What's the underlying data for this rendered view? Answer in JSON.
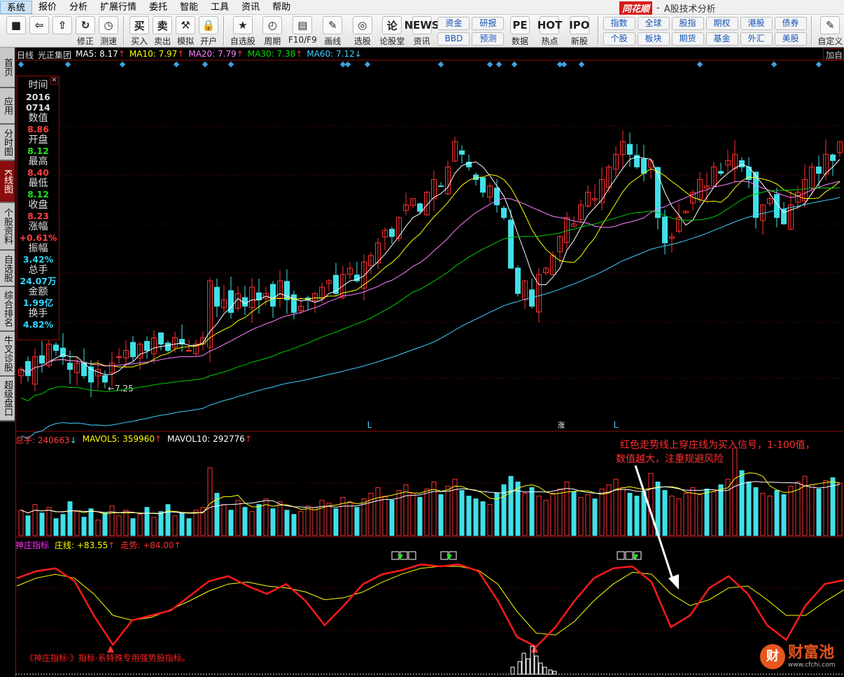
{
  "menu": [
    "系统",
    "报价",
    "分析",
    "扩展行情",
    "委托",
    "智能",
    "工具",
    "资讯",
    "帮助"
  ],
  "app_title": {
    "logo": "同花顺",
    "sep": "-",
    "subtitle": "A股技术分析"
  },
  "toolbar": {
    "left": [
      {
        "icon": "■",
        "label": ""
      },
      {
        "icon": "⇦",
        "label": ""
      },
      {
        "icon": "⇧",
        "label": ""
      },
      {
        "icon": "↻",
        "label": "修正"
      },
      {
        "icon": "◷",
        "label": "测速"
      },
      {
        "icon": "买",
        "label": "买入"
      },
      {
        "icon": "卖",
        "label": "卖出"
      },
      {
        "icon": "⚒",
        "label": "模拟"
      },
      {
        "icon": "🔒",
        "label": "开户"
      },
      {
        "icon": "★",
        "label": "自选股"
      },
      {
        "icon": "◴",
        "label": "周期"
      },
      {
        "icon": "▤",
        "label": "F10/F9"
      },
      {
        "icon": "✎",
        "label": "画线"
      },
      {
        "icon": "◎",
        "label": "选股"
      },
      {
        "icon": "论",
        "label": "论股堂"
      },
      {
        "icon": "NEWS",
        "label": "资讯"
      }
    ],
    "grid1": [
      "资金",
      "研报",
      "BBD",
      "预测"
    ],
    "mid": [
      {
        "icon": "PE",
        "label": "数据"
      },
      {
        "icon": "HOT",
        "label": "热点"
      },
      {
        "icon": "IPO",
        "label": "新股"
      }
    ],
    "grid2": [
      "指数",
      "全球",
      "股指",
      "期权",
      "港股",
      "债券",
      "个股",
      "板块",
      "期货",
      "基金",
      "外汇",
      "美股"
    ],
    "custom": {
      "icon": "✎",
      "label": "自定义"
    }
  },
  "sidebar": [
    "首页",
    "应用",
    "分时图",
    "K线图",
    "个股资料",
    "自选股",
    "综合排名",
    "牛叉诊股",
    "超级盘口"
  ],
  "header": {
    "period": "日线",
    "stock": "光正集团",
    "ma": [
      {
        "label": "MA5: 8.17",
        "arrow": "↑",
        "color": "#ffffff"
      },
      {
        "label": "MA10: 7.97",
        "arrow": "↑",
        "color": "#ffff00"
      },
      {
        "label": "MA20: 7.79",
        "arrow": "↑",
        "color": "#ff80ff"
      },
      {
        "label": "MA30: 7.38",
        "arrow": "↑",
        "color": "#00e000"
      },
      {
        "label": "MA60: 7.12",
        "arrow": "↓",
        "color": "#40d0ff"
      }
    ]
  },
  "add_self": "加自选",
  "infobox": [
    {
      "k": "时间",
      "v": "2016",
      "c": "#dddddd"
    },
    {
      "k": "",
      "v": "0714",
      "c": "#dddddd"
    },
    {
      "k": "数值",
      "v": "8.86",
      "c": "#ff4040"
    },
    {
      "k": "开盘",
      "v": "8.12",
      "c": "#20e020"
    },
    {
      "k": "最高",
      "v": "8.40",
      "c": "#ff4040"
    },
    {
      "k": "最低",
      "v": "8.12",
      "c": "#20e020"
    },
    {
      "k": "收盘",
      "v": "8.23",
      "c": "#ff4040"
    },
    {
      "k": "涨幅",
      "v": "+0.61%",
      "c": "#ff4040"
    },
    {
      "k": "振幅",
      "v": "3.42%",
      "c": "#30d8ff"
    },
    {
      "k": "总手",
      "v": "24.07万",
      "c": "#30d8ff"
    },
    {
      "k": "金额",
      "v": "1.99亿",
      "c": "#30d8ff"
    },
    {
      "k": "换手",
      "v": "4.82%",
      "c": "#30d8ff"
    }
  ],
  "price_panel": {
    "low_label": "7.25",
    "marks": [
      "L",
      "涨",
      "L"
    ]
  },
  "volume_panel": {
    "items": [
      {
        "label": "总手: 240663",
        "arrow": "↓",
        "color": "#ff4040",
        "acolor": "#40d0ff"
      },
      {
        "label": "MAVOL5: 359960",
        "arrow": "↑",
        "color": "#ffff00",
        "acolor": "#ff3030"
      },
      {
        "label": "MAVOL10: 292776",
        "arrow": "↑",
        "color": "#ffffff",
        "acolor": "#ff3030"
      }
    ]
  },
  "indicator_panel": {
    "name": "神庄指标",
    "items": [
      {
        "label": "庄线: +83.55",
        "arrow": "↑",
        "color": "#ffff00"
      },
      {
        "label": "走势: +84.00",
        "arrow": "↑",
        "color": "#ff3030"
      }
    ]
  },
  "annotation": {
    "line1": "红色走势线上穿庄线为买入信号，1-100值，",
    "line2": "数值越大，注重规避风险"
  },
  "footnote": "《神庄指标·》指标·系特殊专用强势股指标。",
  "watermark": {
    "logo": "财",
    "text": "财富池",
    "url": "www.cfchi.com"
  },
  "chart_data": {
    "type": "candlestick",
    "closes": [
      7.4,
      7.35,
      7.5,
      7.45,
      7.6,
      7.55,
      7.5,
      7.4,
      7.45,
      7.35,
      7.3,
      7.4,
      7.3,
      7.45,
      7.5,
      7.55,
      7.5,
      7.6,
      7.55,
      7.65,
      7.6,
      7.55,
      7.65,
      7.6,
      7.55,
      7.6,
      7.65,
      8.1,
      7.9,
      7.95,
      7.85,
      8.0,
      7.9,
      8.05,
      7.95,
      8.0,
      7.9,
      8.1,
      7.95,
      7.85,
      7.9,
      7.95,
      8.0,
      8.05,
      8.1,
      8.0,
      8.15,
      8.2,
      8.1,
      8.25,
      8.3,
      8.4,
      8.5,
      8.45,
      8.6,
      8.7,
      8.75,
      8.65,
      8.8,
      8.9,
      8.85,
      9.0,
      9.2,
      9.1,
      9.0,
      8.9,
      8.8,
      8.85,
      8.7,
      8.6,
      8.2,
      8.0,
      8.1,
      7.9,
      8.15,
      8.2,
      8.3,
      8.45,
      8.6,
      8.55,
      8.7,
      8.8,
      8.75,
      8.9,
      9.0,
      9.1,
      9.2,
      9.1,
      9.0,
      8.95,
      9.05,
      8.6,
      8.4,
      8.45,
      8.6,
      8.65,
      8.8,
      8.9,
      8.85,
      9.0,
      8.95,
      9.05,
      9.1,
      9.0,
      8.9,
      8.6,
      8.7,
      8.75,
      8.6,
      8.55,
      8.7,
      8.8,
      8.9,
      9.0,
      8.95,
      9.1,
      9.05,
      9.2
    ],
    "volumes": [
      18,
      14,
      22,
      16,
      20,
      12,
      15,
      24,
      17,
      13,
      19,
      11,
      16,
      21,
      14,
      18,
      12,
      15,
      20,
      13,
      17,
      22,
      14,
      16,
      12,
      18,
      20,
      48,
      30,
      22,
      18,
      25,
      20,
      17,
      22,
      26,
      19,
      24,
      18,
      15,
      17,
      21,
      20,
      25,
      23,
      19,
      27,
      24,
      20,
      26,
      30,
      34,
      28,
      25,
      32,
      36,
      30,
      27,
      33,
      38,
      29,
      35,
      40,
      32,
      28,
      26,
      24,
      22,
      30,
      36,
      42,
      38,
      30,
      34,
      28,
      25,
      30,
      33,
      38,
      31,
      27,
      29,
      26,
      33,
      36,
      40,
      34,
      30,
      28,
      31,
      44,
      38,
      32,
      28,
      26,
      30,
      34,
      29,
      33,
      31,
      36,
      40,
      62,
      46,
      38,
      34,
      30,
      28,
      32,
      29,
      35,
      38,
      42,
      36,
      33,
      39,
      41,
      37
    ],
    "price_range": [
      7.0,
      9.6
    ],
    "indicator": {
      "range": [
        0,
        100
      ],
      "trend": [
        78,
        85,
        88,
        75,
        40,
        10,
        35,
        40,
        45,
        60,
        75,
        80,
        70,
        62,
        72,
        55,
        30,
        50,
        72,
        82,
        86,
        92,
        90,
        92,
        85,
        55,
        18,
        8,
        28,
        55,
        78,
        88,
        90,
        74,
        28,
        40,
        68,
        80,
        62,
        30,
        15,
        50,
        72,
        76
      ],
      "zhuang": [
        70,
        78,
        82,
        78,
        62,
        40,
        35,
        38,
        46,
        55,
        65,
        72,
        74,
        70,
        68,
        64,
        56,
        58,
        64,
        74,
        82,
        88,
        90,
        90,
        86,
        72,
        44,
        22,
        20,
        34,
        55,
        72,
        84,
        82,
        62,
        50,
        56,
        68,
        70,
        56,
        40,
        40,
        54,
        66
      ]
    }
  }
}
